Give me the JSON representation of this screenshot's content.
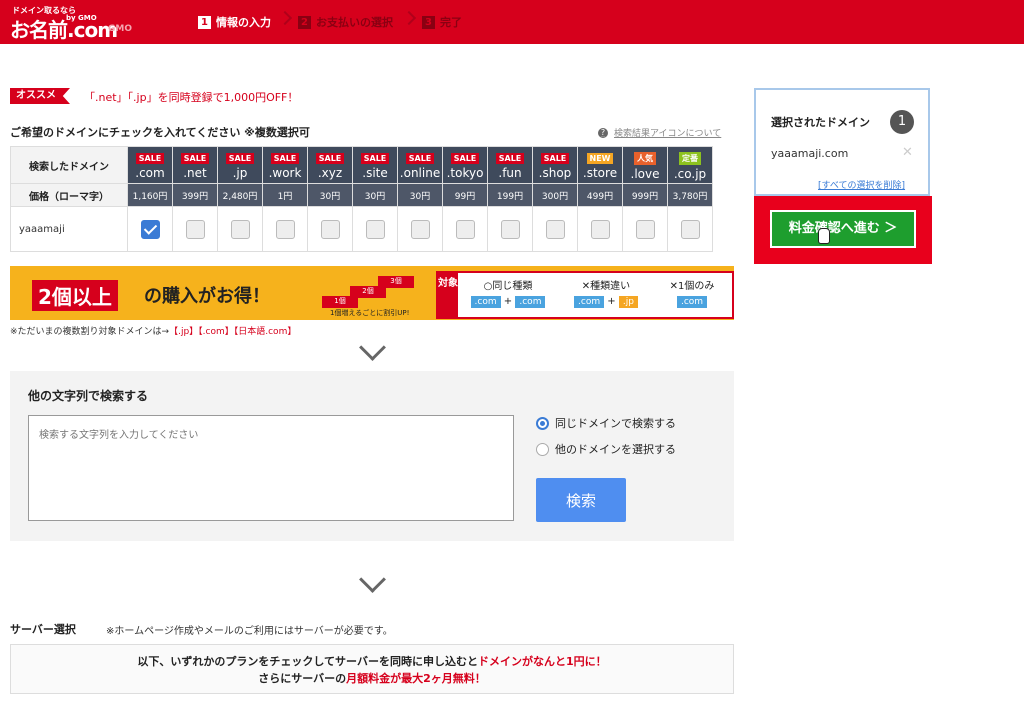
{
  "header": {
    "logo_tagline": "ドメイン取るなら",
    "logo_name": "お名前.com",
    "logo_brand": "by GMO",
    "logo_sub": "GMO",
    "steps": [
      {
        "num": "1",
        "label": "情報の入力",
        "active": true
      },
      {
        "num": "2",
        "label": "お支払いの選択",
        "active": false
      },
      {
        "num": "3",
        "label": "完了",
        "active": false
      }
    ]
  },
  "recommend": {
    "tag": "オススメ",
    "text": "「.net」「.jp」を同時登録で1,000円OFF！"
  },
  "checklist": {
    "title": "ご希望のドメインにチェックを入れてください ※複数選択可",
    "help_link": "検索結果アイコンについて",
    "help_icon": "question-circle-icon"
  },
  "table": {
    "header_label": "検索したドメイン",
    "price_label": "価格（ローマ字）",
    "search_word": "yaaamaji",
    "tlds": [
      {
        "badge": "SALE",
        "badge_type": "sale",
        "tld": ".com",
        "price": "1,160円",
        "checked": true
      },
      {
        "badge": "SALE",
        "badge_type": "sale",
        "tld": ".net",
        "price": "399円",
        "checked": false
      },
      {
        "badge": "SALE",
        "badge_type": "sale",
        "tld": ".jp",
        "price": "2,480円",
        "checked": false
      },
      {
        "badge": "SALE",
        "badge_type": "sale",
        "tld": ".work",
        "price": "1円",
        "checked": false
      },
      {
        "badge": "SALE",
        "badge_type": "sale",
        "tld": ".xyz",
        "price": "30円",
        "checked": false
      },
      {
        "badge": "SALE",
        "badge_type": "sale",
        "tld": ".site",
        "price": "30円",
        "checked": false
      },
      {
        "badge": "SALE",
        "badge_type": "sale",
        "tld": ".online",
        "price": "30円",
        "checked": false
      },
      {
        "badge": "SALE",
        "badge_type": "sale",
        "tld": ".tokyo",
        "price": "99円",
        "checked": false
      },
      {
        "badge": "SALE",
        "badge_type": "sale",
        "tld": ".fun",
        "price": "199円",
        "checked": false
      },
      {
        "badge": "SALE",
        "badge_type": "sale",
        "tld": ".shop",
        "price": "300円",
        "checked": false
      },
      {
        "badge": "NEW",
        "badge_type": "new",
        "tld": ".store",
        "price": "499円",
        "checked": false
      },
      {
        "badge": "人気",
        "badge_type": "pop",
        "tld": ".love",
        "price": "999円",
        "checked": false
      },
      {
        "badge": "定番",
        "badge_type": "std",
        "tld": ".co.jp",
        "price": "3,780円",
        "checked": false
      }
    ]
  },
  "banner": {
    "highlight": "2個以上",
    "text": "の購入がお得！",
    "stair_labels": [
      "1個",
      "2個",
      "3個"
    ],
    "stair_sub": "1個増えるごとに割引UP!",
    "target_label": "対象",
    "cols": [
      {
        "head": "○同じ種類",
        "a": ".com",
        "b": ".com"
      },
      {
        "head": "✕種類違い",
        "a": ".com",
        "b": ".jp"
      },
      {
        "head": "✕1個のみ",
        "a": ".com"
      }
    ]
  },
  "note": {
    "prefix": "※ただいまの複数割り対象ドメインは→",
    "items": "【.jp】【.com】【日本語.com】"
  },
  "search": {
    "title": "他の文字列で検索する",
    "placeholder": "検索する文字列を入力してください",
    "radio_same": "同じドメインで検索する",
    "radio_other": "他のドメインを選択する",
    "button": "検索"
  },
  "server": {
    "title": "サーバー選択",
    "note": "※ホームページ作成やメールのご利用にはサーバーが必要です。",
    "line1_a": "以下、いずれかのプランをチェックしてサーバーを同時に申し込むと",
    "line1_b": "ドメインがなんと1円に！",
    "line2_a": "さらにサーバーの",
    "line2_b": "月額料金が最大2ヶ月無料！"
  },
  "sidebar": {
    "title": "選択されたドメイン",
    "count": "1",
    "domain": "yaaamaji.com",
    "clear_link": "[すべての選択を削除]",
    "button": "料金確認へ進む ＞"
  },
  "colors": {
    "brand_red": "#d6001c",
    "go_green": "#1e9e2e",
    "search_blue": "#4f8ef0"
  }
}
